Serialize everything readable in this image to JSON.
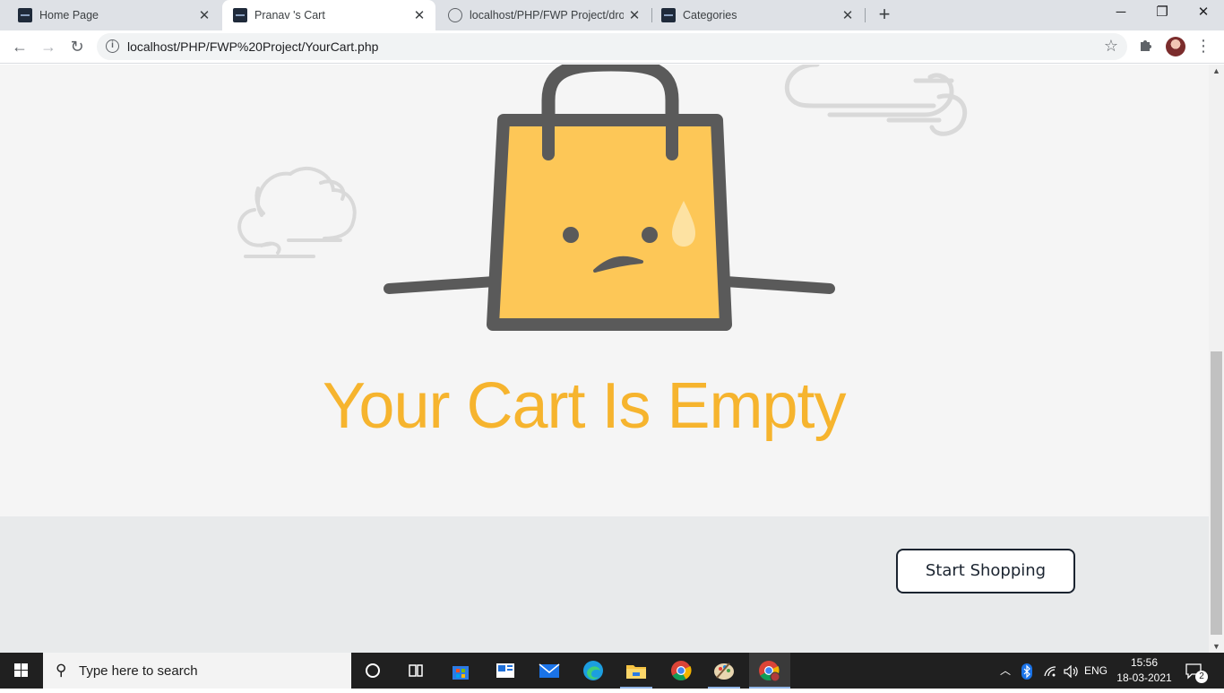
{
  "browser": {
    "tabs": [
      {
        "title": "Home Page",
        "favicon": "dark-site-icon",
        "active": false
      },
      {
        "title": "Pranav 's Cart",
        "favicon": "dark-site-icon",
        "active": true
      },
      {
        "title": "localhost/PHP/FWP Project/drop",
        "favicon": "globe-icon",
        "active": false
      },
      {
        "title": "Categories",
        "favicon": "dark-site-icon",
        "active": false
      }
    ],
    "url": "localhost/PHP/FWP%20Project/YourCart.php"
  },
  "page": {
    "empty_message": "Your Cart Is Empty",
    "start_button": "Start Shopping",
    "colors": {
      "accent": "#f6b42e",
      "bag": "#fdc757",
      "outline": "#5a5a5a",
      "button_border": "#1b2430"
    }
  },
  "taskbar": {
    "search_placeholder": "Type here to search",
    "language": "ENG",
    "time": "15:56",
    "date": "18-03-2021",
    "notification_count": "2"
  }
}
